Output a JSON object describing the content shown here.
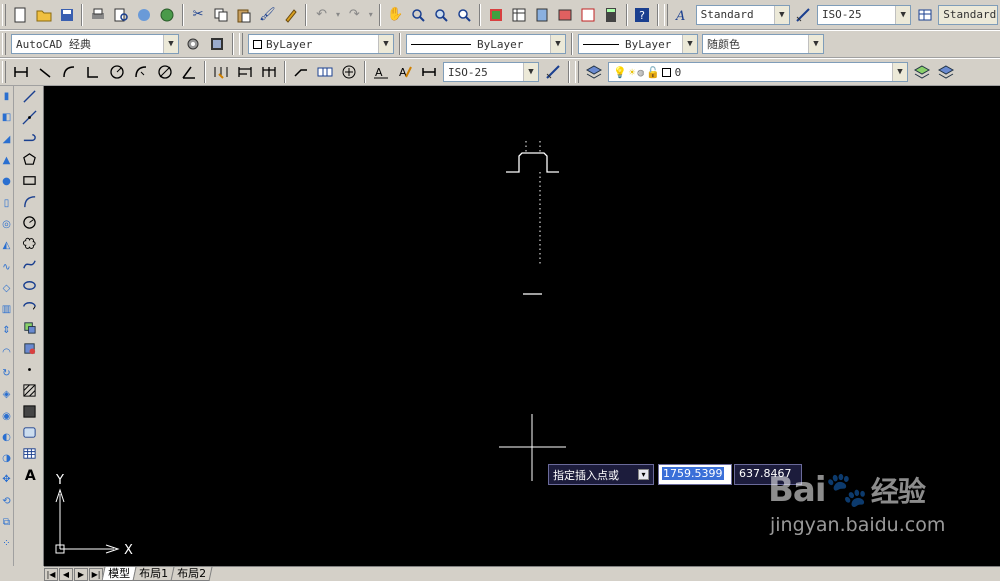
{
  "toolbar1": {
    "text_style": "Standard",
    "dim_style": "ISO-25",
    "table_style": "Standard"
  },
  "toolbar2": {
    "workspace": "AutoCAD 经典",
    "color": "ByLayer",
    "linetype": "ByLayer",
    "lineweight": "ByLayer",
    "plot_style": "随颜色"
  },
  "toolbar3": {
    "dim_style": "ISO-25",
    "layer": "0"
  },
  "canvas": {
    "background": "#000000",
    "ucs_x_label": "X",
    "ucs_y_label": "Y"
  },
  "dynamic_input": {
    "prompt": "指定插入点或",
    "x_value": "1759.5399",
    "y_value": "637.8467"
  },
  "tabs": {
    "model": "模型",
    "layout1": "布局1",
    "layout2": "布局2"
  },
  "watermark": {
    "brand_text": "Bai",
    "brand_cn": "经验",
    "url": "jingyan.baidu.com"
  }
}
